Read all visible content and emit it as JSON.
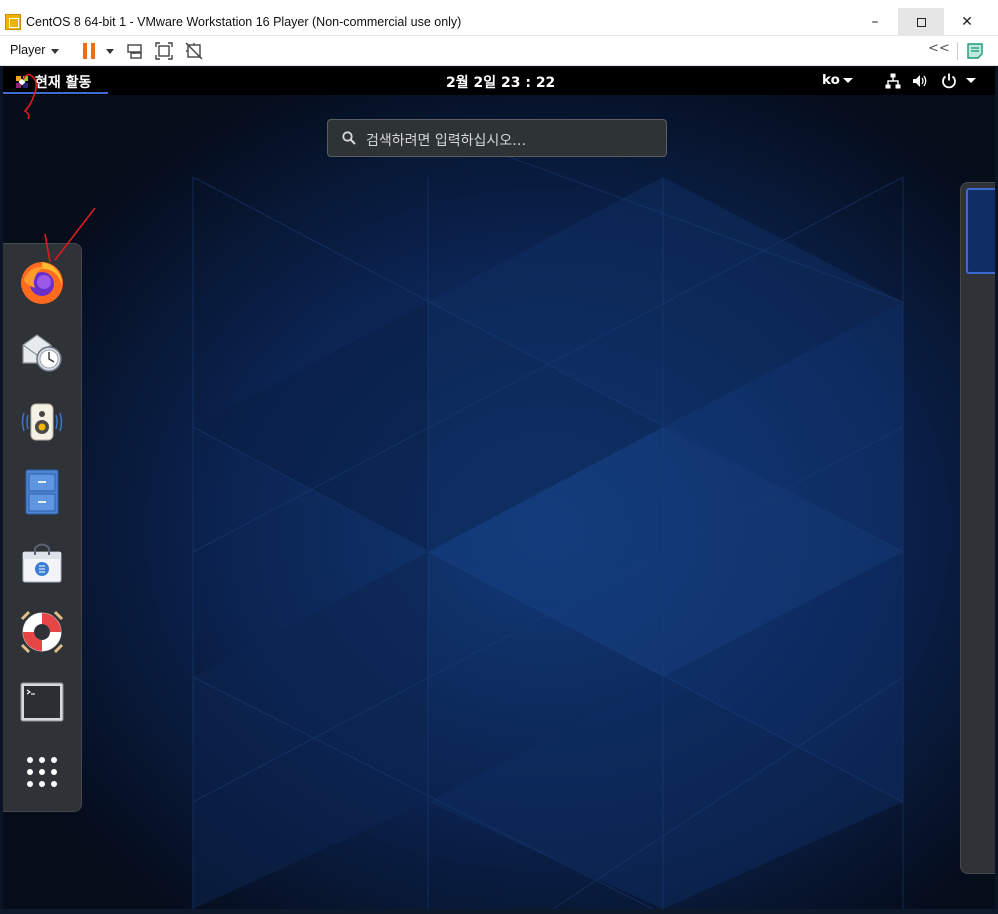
{
  "window": {
    "title": "CentOS 8 64-bit 1 - VMware Workstation 16 Player (Non-commercial use only)",
    "controls": {
      "minimize": "–",
      "close": "✕"
    }
  },
  "toolbar": {
    "player_label": "Player",
    "rewind_label": "<<"
  },
  "gnome": {
    "activities_label": "현재 활동",
    "clock": "2월 2일  23 : 22",
    "language": "ko",
    "search_placeholder": "검색하려면 입력하십시오…"
  },
  "dock": {
    "items": [
      {
        "name": "firefox"
      },
      {
        "name": "evolution-mail"
      },
      {
        "name": "rhythmbox"
      },
      {
        "name": "files"
      },
      {
        "name": "software"
      },
      {
        "name": "help"
      },
      {
        "name": "terminal"
      },
      {
        "name": "show-applications"
      }
    ]
  },
  "colors": {
    "accent": "#3f6bd1",
    "pause": "#e8701a",
    "annotation": "#d81e1e",
    "topbar": "#000000",
    "dock": "#2f3236"
  }
}
